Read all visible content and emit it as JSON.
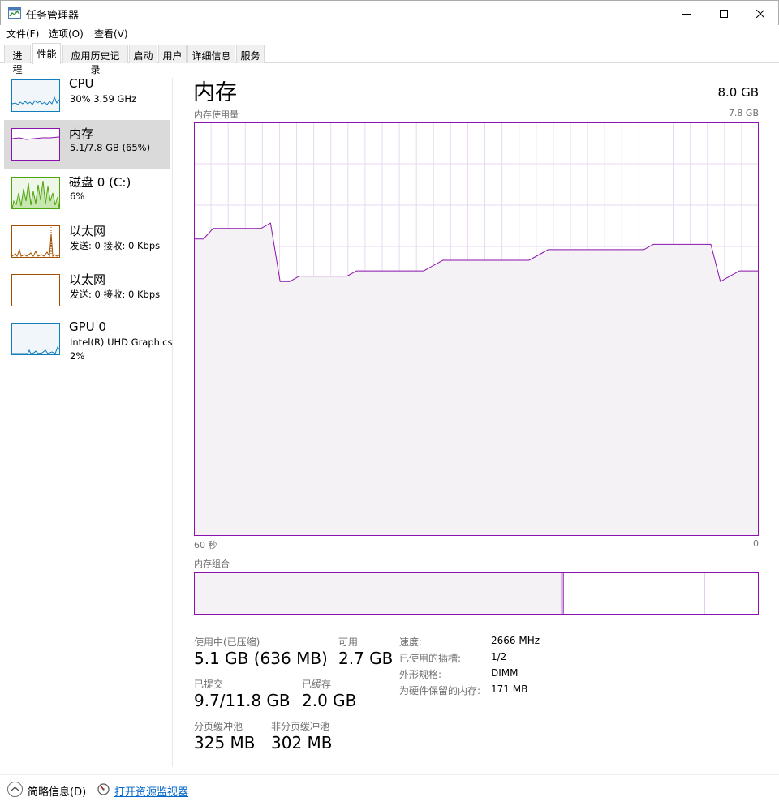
{
  "window": {
    "title": "任务管理器"
  },
  "menu": {
    "file": "文件(F)",
    "options": "选项(O)",
    "view": "查看(V)"
  },
  "tabs": [
    "进程",
    "性能",
    "应用历史记录",
    "启动",
    "用户",
    "详细信息",
    "服务"
  ],
  "sidebar": {
    "items": [
      {
        "title": "CPU",
        "sub": "30% 3.59 GHz",
        "sub2": "",
        "color": "#117dbb"
      },
      {
        "title": "内存",
        "sub": "5.1/7.8 GB (65%)",
        "sub2": "",
        "color": "#8b12ae"
      },
      {
        "title": "磁盘 0 (C:)",
        "sub": "6%",
        "sub2": "",
        "color": "#4da60c"
      },
      {
        "title": "以太网",
        "sub": "发送: 0  接收: 0 Kbps",
        "sub2": "",
        "color": "#a74f01"
      },
      {
        "title": "以太网",
        "sub": "发送: 0  接收: 0 Kbps",
        "sub2": "",
        "color": "#a74f01"
      },
      {
        "title": "GPU 0",
        "sub": "Intel(R) UHD Graphics",
        "sub2": "2%",
        "color": "#117dbb"
      }
    ]
  },
  "main": {
    "title": "内存",
    "total": "8.0 GB",
    "usage_label": "内存使用量",
    "usage_max": "7.8 GB",
    "time_start": "60 秒",
    "time_end": "0",
    "composition_label": "内存组合"
  },
  "chart_data": {
    "type": "area",
    "title": "内存使用量",
    "xlabel": "",
    "ylabel": "",
    "xlim": [
      60,
      0
    ],
    "ylim": [
      0,
      7.8
    ],
    "x_tick_labels": [
      "60 秒",
      "0"
    ],
    "grid": true,
    "series": [
      {
        "color": "#8b12ae",
        "values": [
          5.6,
          5.6,
          5.8,
          5.8,
          5.8,
          5.8,
          5.8,
          5.8,
          5.9,
          4.8,
          4.8,
          4.9,
          4.9,
          4.9,
          4.9,
          4.9,
          4.9,
          5.0,
          5.0,
          5.0,
          5.0,
          5.0,
          5.0,
          5.0,
          5.0,
          5.1,
          5.2,
          5.2,
          5.2,
          5.2,
          5.2,
          5.2,
          5.2,
          5.2,
          5.2,
          5.2,
          5.3,
          5.4,
          5.4,
          5.4,
          5.4,
          5.4,
          5.4,
          5.4,
          5.4,
          5.4,
          5.4,
          5.4,
          5.5,
          5.5,
          5.5,
          5.5,
          5.5,
          5.5,
          5.5,
          4.8,
          4.9,
          5.0,
          5.0,
          5.0
        ]
      }
    ],
    "composition": {
      "in_use_fraction": 0.65,
      "modified_fraction": 0.004,
      "standby_fraction": 0.25,
      "free_fraction": 0.1
    }
  },
  "stats": {
    "in_use_label": "使用中(已压缩)",
    "in_use_value": "5.1 GB (636 MB)",
    "available_label": "可用",
    "available_value": "2.7 GB",
    "committed_label": "已提交",
    "committed_value": "9.7/11.8 GB",
    "cached_label": "已缓存",
    "cached_value": "2.0 GB",
    "paged_label": "分页缓冲池",
    "paged_value": "325 MB",
    "nonpaged_label": "非分页缓冲池",
    "nonpaged_value": "302 MB"
  },
  "specs": {
    "speed_label": "速度:",
    "speed_value": "2666 MHz",
    "slots_label": "已使用的插槽:",
    "slots_value": "1/2",
    "form_label": "外形规格:",
    "form_value": "DIMM",
    "reserved_label": "为硬件保留的内存:",
    "reserved_value": "171 MB"
  },
  "footer": {
    "brief": "简略信息(D)",
    "resmon": "打开资源监视器"
  }
}
